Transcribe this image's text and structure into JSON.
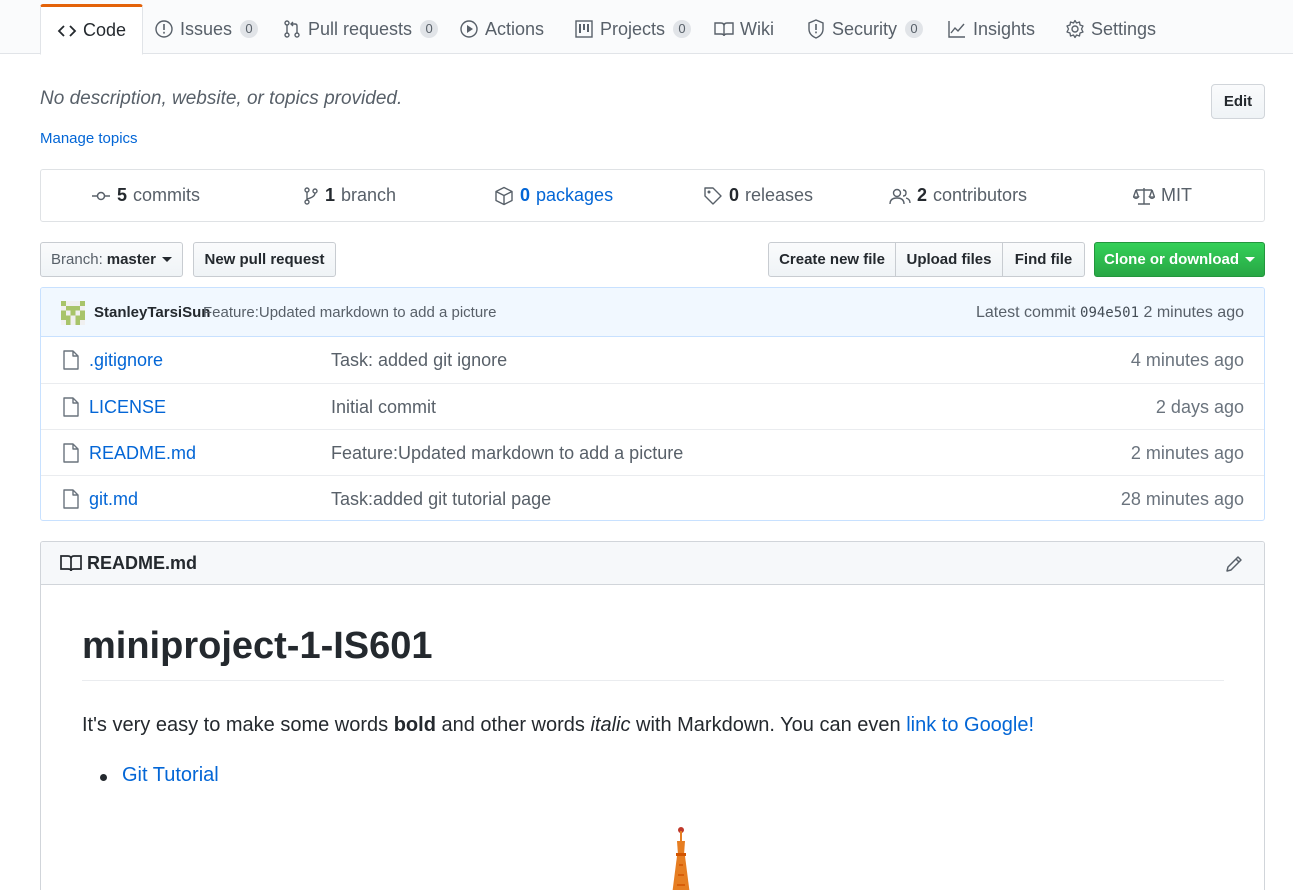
{
  "nav": {
    "tabs": [
      {
        "label": "Code",
        "icon": "code-icon",
        "selected": true
      },
      {
        "label": "Issues",
        "icon": "issue-icon",
        "count": "0"
      },
      {
        "label": "Pull requests",
        "icon": "pull-request-icon",
        "count": "0"
      },
      {
        "label": "Actions",
        "icon": "play-icon"
      },
      {
        "label": "Projects",
        "icon": "project-icon",
        "count": "0"
      },
      {
        "label": "Wiki",
        "icon": "book-icon"
      },
      {
        "label": "Security",
        "icon": "shield-icon",
        "count": "0"
      },
      {
        "label": "Insights",
        "icon": "graph-icon"
      },
      {
        "label": "Settings",
        "icon": "gear-icon"
      }
    ]
  },
  "repo": {
    "description": "No description, website, or topics provided.",
    "edit_label": "Edit",
    "manage_topics": "Manage topics"
  },
  "summary": {
    "commits": {
      "count": "5",
      "label": "commits"
    },
    "branches": {
      "count": "1",
      "label": "branch"
    },
    "packages": {
      "count": "0",
      "label": "packages"
    },
    "releases": {
      "count": "0",
      "label": "releases"
    },
    "contributors": {
      "count": "2",
      "label": "contributors"
    },
    "license": "MIT"
  },
  "toolbar": {
    "branch_prefix": "Branch:",
    "branch_name": "master",
    "new_pull_request": "New pull request",
    "create_new_file": "Create new file",
    "upload_files": "Upload files",
    "find_file": "Find file",
    "clone_or_download": "Clone or download"
  },
  "latest_commit": {
    "author": "StanleyTarsiSun",
    "message": "Feature:Updated markdown to add a picture",
    "prefix": "Latest commit",
    "sha": "094e501",
    "age": "2 minutes ago"
  },
  "files": [
    {
      "name": ".gitignore",
      "message": "Task: added git ignore",
      "age": "4 minutes ago"
    },
    {
      "name": "LICENSE",
      "message": "Initial commit",
      "age": "2 days ago"
    },
    {
      "name": "README.md",
      "message": "Feature:Updated markdown to add a picture",
      "age": "2 minutes ago"
    },
    {
      "name": "git.md",
      "message": "Task:added git tutorial page",
      "age": "28 minutes ago"
    }
  ],
  "readme": {
    "filename": "README.md",
    "heading": "miniproject-1-IS601",
    "para_1": "It's very easy to make some words ",
    "para_bold": "bold",
    "para_2": " and other words ",
    "para_italic": "italic",
    "para_3": " with Markdown. You can even ",
    "para_link": "link to Google!",
    "list_item": "Git Tutorial"
  },
  "colors": {
    "accent_tab": "#e36209",
    "link": "#0366d6",
    "clone_green": "#28a745",
    "commit_bar_bg": "#f1f8ff"
  }
}
